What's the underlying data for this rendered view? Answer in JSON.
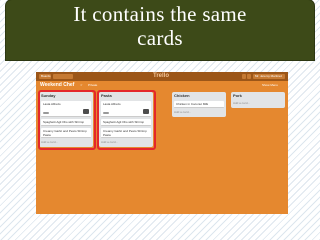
{
  "slide": {
    "title_line1": "It contains the same",
    "title_line2": "cards"
  },
  "app": {
    "topbar": {
      "boards_label": "Boards",
      "search_placeholder": "",
      "logo": "Trello",
      "user_name": "Mr. Jeremy Martinez"
    },
    "board": {
      "name": "Weekend Chef",
      "star_icon": "star-icon",
      "visibility": "Private",
      "menu_label": "Show Menu"
    },
    "lists": [
      {
        "title": "Sunday",
        "cards": [
          "Lasta Alfredo",
          "Spaghetti Agli Olio with Shrimp",
          "Creamy Garlic and Pesto Shrimp Pasta"
        ],
        "add_label": "Add a card..."
      },
      {
        "title": "Pasta",
        "cards": [
          "Lasta Alfredo",
          "Spaghetti Agli Olio with Shrimp",
          "Creamy Garlic and Pesto Shrimp Pasta"
        ],
        "add_label": "Add a card..."
      },
      {
        "title": "Chicken",
        "cards": [
          "Chicken in Coconut Milk"
        ],
        "add_label": "Add a card..."
      },
      {
        "title": "Pork",
        "cards": [],
        "add_label": "Add a card..."
      }
    ]
  },
  "colors": {
    "title_bg": "#3d4a18",
    "board_bg": "#e5882f",
    "topbar_bg": "#9c5618",
    "highlight": "#e4272b"
  }
}
